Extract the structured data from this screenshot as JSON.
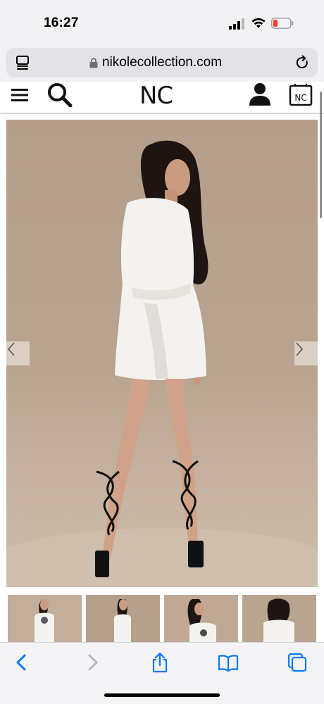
{
  "status_bar": {
    "time": "16:27",
    "battery_color": "#ff3b30"
  },
  "browser": {
    "url": "nikolecollection.com"
  },
  "site": {
    "logo": "NC",
    "cart_badge": "NC"
  },
  "gallery": {
    "main_image": "model-white-sleeveless-wrap-dress-back-view",
    "thumbnail_count": 4
  },
  "toolbar": {
    "items": [
      "back-icon",
      "forward-icon",
      "share-icon",
      "bookmarks-icon",
      "tabs-icon"
    ],
    "accent": "#0a7aff"
  }
}
